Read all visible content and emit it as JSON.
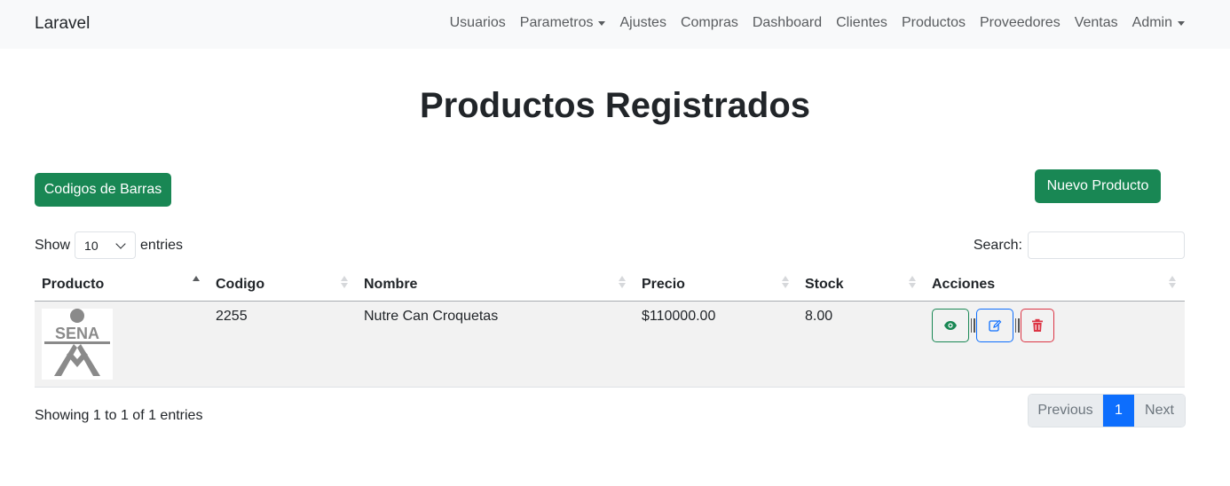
{
  "navbar": {
    "brand": "Laravel",
    "items": [
      {
        "label": "Usuarios",
        "dropdown": false
      },
      {
        "label": "Parametros",
        "dropdown": true
      },
      {
        "label": "Ajustes",
        "dropdown": false
      },
      {
        "label": "Compras",
        "dropdown": false
      },
      {
        "label": "Dashboard",
        "dropdown": false
      },
      {
        "label": "Clientes",
        "dropdown": false
      },
      {
        "label": "Productos",
        "dropdown": false
      },
      {
        "label": "Proveedores",
        "dropdown": false
      },
      {
        "label": "Ventas",
        "dropdown": false
      },
      {
        "label": "Admin",
        "dropdown": true
      }
    ]
  },
  "page": {
    "title": "Productos Registrados",
    "barcodes_button": "Codigos de Barras",
    "new_product_button": "Nuevo Producto"
  },
  "table_controls": {
    "show_label": "Show",
    "entries_value": "10",
    "entries_label": "entries",
    "search_label": "Search:",
    "search_value": ""
  },
  "table": {
    "headers": [
      "Producto",
      "Codigo",
      "Nombre",
      "Precio",
      "Stock",
      "Acciones"
    ],
    "sorted_column": "Producto",
    "sort_direction": "ascending",
    "rows": [
      {
        "image": "SENA",
        "codigo": "2255",
        "nombre": "Nutre Can Croquetas",
        "precio": "$110000.00",
        "stock": "8.00",
        "actions": [
          "eye-icon",
          "edit-icon",
          "trash-icon"
        ]
      }
    ]
  },
  "footer": {
    "info": "Showing 1 to 1 of 1 entries",
    "pagination": {
      "previous": "Previous",
      "current": "1",
      "next": "Next"
    }
  },
  "colors": {
    "success": "#198754",
    "primary": "#0d6efd",
    "danger": "#dc3545",
    "navbar_bg": "#f8f9fa",
    "row_bg": "#f2f2f2"
  }
}
